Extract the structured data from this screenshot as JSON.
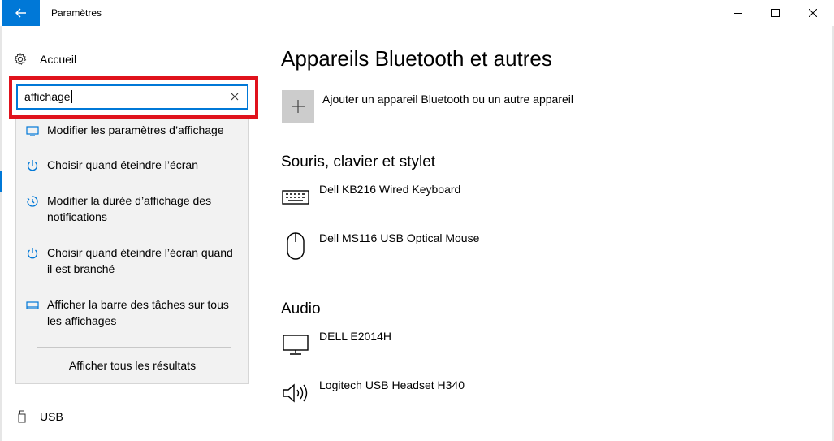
{
  "window": {
    "title": "Paramètres",
    "accent": "#0078d7",
    "highlight_color": "#e0121c"
  },
  "sidebar": {
    "home_label": "Accueil",
    "search": {
      "value": "affichage"
    },
    "suggestions": [
      {
        "icon": "display-icon",
        "label": "Modifier les paramètres d’affichage"
      },
      {
        "icon": "power-icon",
        "label": "Choisir quand éteindre l’écran"
      },
      {
        "icon": "notification-timer-icon",
        "label": "Modifier la durée d’affichage des notifications"
      },
      {
        "icon": "power-icon",
        "label": "Choisir quand éteindre l’écran quand il est branché"
      },
      {
        "icon": "taskbar-icon",
        "label": "Afficher la barre des tâches sur tous les affichages"
      }
    ],
    "show_all_label": "Afficher tous les résultats",
    "usb_label": "USB"
  },
  "main": {
    "title": "Appareils Bluetooth et autres",
    "add_device_label": "Ajouter un appareil Bluetooth ou un autre appareil",
    "sections": [
      {
        "title": "Souris, clavier et stylet",
        "devices": [
          {
            "icon": "keyboard-icon",
            "name": "Dell KB216 Wired Keyboard"
          },
          {
            "icon": "mouse-icon",
            "name": "Dell MS116 USB Optical Mouse"
          }
        ]
      },
      {
        "title": "Audio",
        "devices": [
          {
            "icon": "monitor-icon",
            "name": "DELL E2014H"
          },
          {
            "icon": "speaker-icon",
            "name": "Logitech USB Headset H340"
          }
        ]
      }
    ]
  }
}
